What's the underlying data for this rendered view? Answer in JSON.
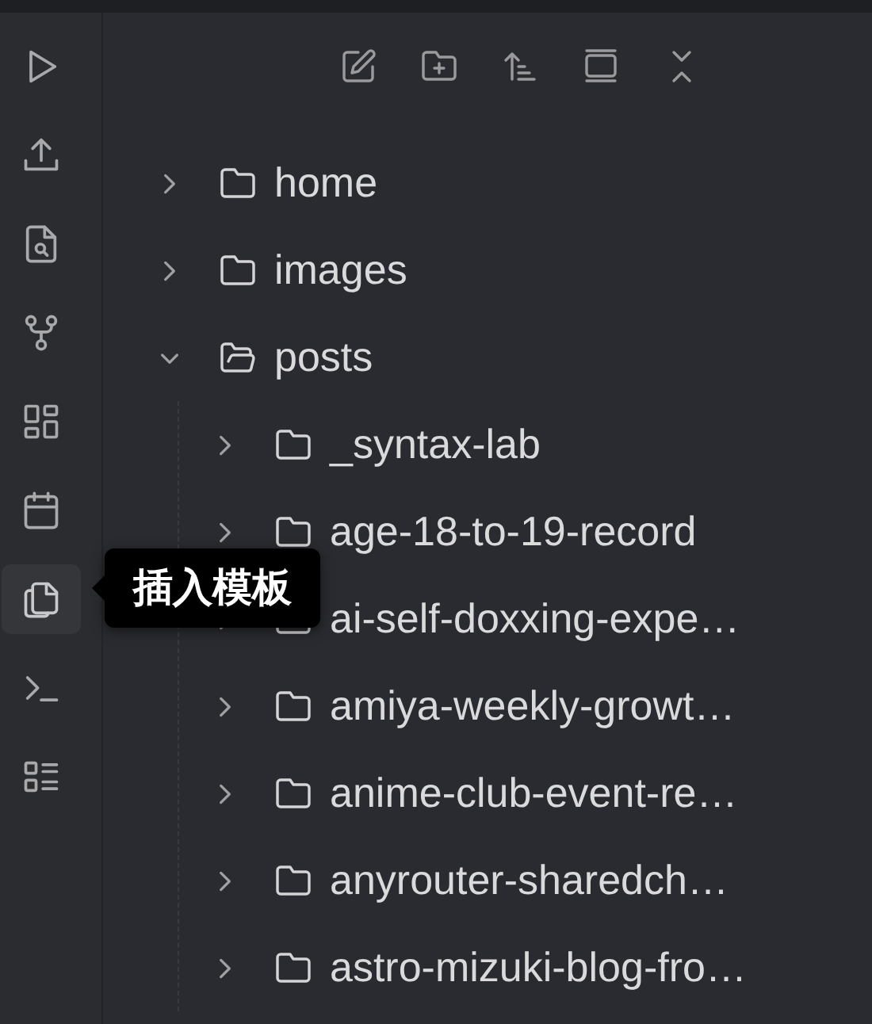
{
  "ribbon": [
    {
      "kind": "play",
      "selected": false
    },
    {
      "kind": "upload",
      "selected": false
    },
    {
      "kind": "file-search",
      "selected": false
    },
    {
      "kind": "branch",
      "selected": false
    },
    {
      "kind": "grid",
      "selected": false
    },
    {
      "kind": "calendar",
      "selected": false
    },
    {
      "kind": "copy",
      "selected": true
    },
    {
      "kind": "terminal",
      "selected": false
    },
    {
      "kind": "list",
      "selected": false
    }
  ],
  "tooltip": {
    "text": "插入模板"
  },
  "toolbar": [
    {
      "kind": "edit"
    },
    {
      "kind": "folder-plus"
    },
    {
      "kind": "sort"
    },
    {
      "kind": "window"
    },
    {
      "kind": "collapse"
    }
  ],
  "tree": [
    {
      "name": "home",
      "expanded": false
    },
    {
      "name": "images",
      "expanded": false
    },
    {
      "name": "posts",
      "expanded": true,
      "children": [
        {
          "name": "_syntax-lab",
          "expanded": false
        },
        {
          "name": "age-18-to-19-record",
          "expanded": false
        },
        {
          "name": "ai-self-doxxing-expe…",
          "expanded": false
        },
        {
          "name": "amiya-weekly-growt…",
          "expanded": false
        },
        {
          "name": "anime-club-event-re…",
          "expanded": false
        },
        {
          "name": "anyrouter-sharedch…",
          "expanded": false
        },
        {
          "name": "astro-mizuki-blog-fro…",
          "expanded": false
        }
      ]
    }
  ]
}
